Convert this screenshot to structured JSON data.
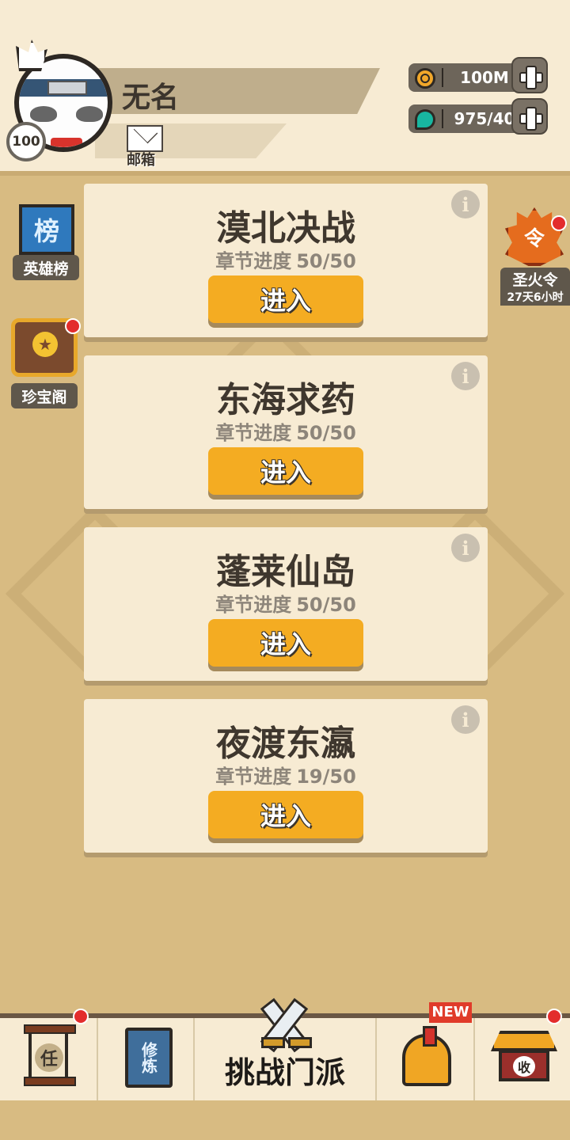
{
  "player": {
    "name": "无名",
    "level": "100",
    "mail_label": "邮箱"
  },
  "resources": {
    "coins": "100M",
    "gems": "975/40"
  },
  "side_left": {
    "ranking_label": "英雄榜",
    "ranking_icon_char": "榜",
    "treasure_label": "珍宝阁"
  },
  "side_right": {
    "token_label": "圣火令",
    "token_icon_char": "令",
    "token_time": "27天6小时"
  },
  "chapters": [
    {
      "title": "漠北决战",
      "progress_label": "章节进度",
      "progress": "50/50",
      "button": "进入"
    },
    {
      "title": "东海求药",
      "progress_label": "章节进度",
      "progress": "50/50",
      "button": "进入"
    },
    {
      "title": "蓬莱仙岛",
      "progress_label": "章节进度",
      "progress": "50/50",
      "button": "进入"
    },
    {
      "title": "夜渡东瀛",
      "progress_label": "章节进度",
      "progress": "19/50",
      "button": "进入"
    }
  ],
  "info_glyph": "i",
  "bottom_nav": {
    "task_char": "任",
    "train_label": "修炼",
    "challenge_label": "挑战门派",
    "new_badge": "NEW",
    "collect_char": "收"
  },
  "colors": {
    "accent_button": "#f4ac22",
    "background": "#d8bb82",
    "card": "#f7ebd3",
    "badge_red": "#e32c2c"
  },
  "icons": [
    "gear-icon",
    "mail-icon",
    "coin-icon",
    "gem-icon",
    "plus-icon",
    "info-icon",
    "banner-icon",
    "chest-icon",
    "flame-token-icon",
    "scroll-icon",
    "book-icon",
    "swords-icon",
    "helmet-icon",
    "house-icon"
  ]
}
